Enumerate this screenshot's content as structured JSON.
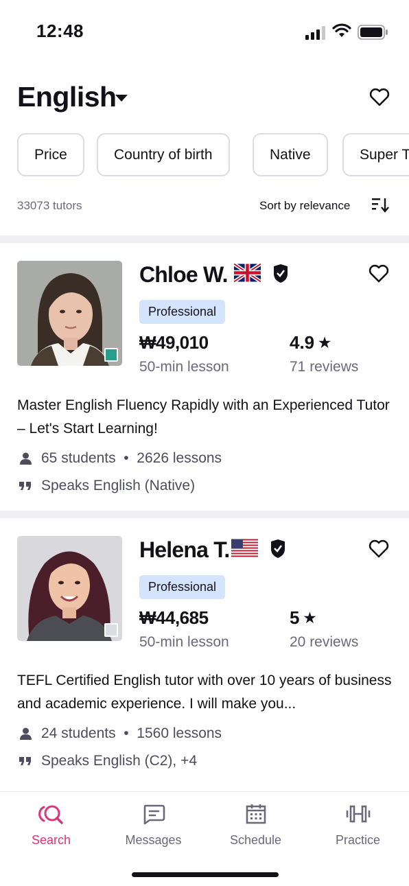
{
  "status_bar": {
    "time": "12:48"
  },
  "header": {
    "title": "English"
  },
  "filters": [
    "Price",
    "Country of birth",
    "Native",
    "Super T"
  ],
  "results": {
    "count": "33073 tutors",
    "sort_label": "Sort by relevance"
  },
  "tutors": [
    {
      "name": "Chloe W.",
      "flag": "uk-flag",
      "badge": "Professional",
      "price": "₩49,010",
      "price_sub": "50-min lesson",
      "rating": "4.9",
      "reviews": "71 reviews",
      "headline": "Master English Fluency Rapidly with an Experienced Tutor – Let's Start Learning!",
      "students": "65 students",
      "lessons": "2626 lessons",
      "speaks": "Speaks English (Native)",
      "online_color": "#2a9d8f"
    },
    {
      "name": "Helena T.",
      "flag": "us-flag",
      "badge": "Professional",
      "price": "₩44,685",
      "price_sub": "50-min lesson",
      "rating": "5",
      "reviews": "20 reviews",
      "headline": "TEFL Certified English tutor with over 10 years of business and academic experience. I will make you...",
      "students": "24 students",
      "lessons": "1560 lessons",
      "speaks": "Speaks English (C2), +4",
      "online_color": "#dcdce5"
    }
  ],
  "tab_bar": {
    "items": [
      {
        "label": "Search",
        "icon": "search-icon",
        "active": true
      },
      {
        "label": "Messages",
        "icon": "messages-icon",
        "active": false
      },
      {
        "label": "Schedule",
        "icon": "calendar-icon",
        "active": false
      },
      {
        "label": "Practice",
        "icon": "dumbbell-icon",
        "active": false
      }
    ]
  },
  "colors": {
    "accent": "#d8357a",
    "badge_bg": "#d4e4ff",
    "divider": "#f0f0f4"
  }
}
